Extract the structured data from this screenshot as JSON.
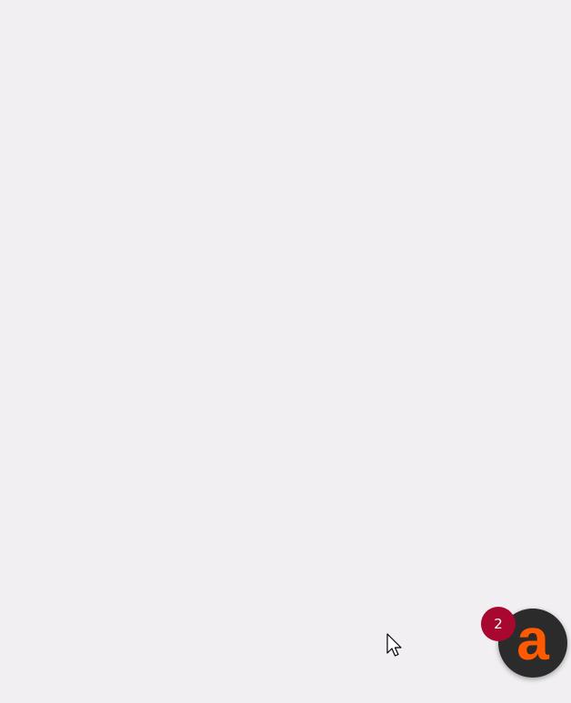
{
  "launcher": {
    "icon": "a-logo-icon",
    "letter": "a",
    "background_color": "#2b2b2b",
    "letter_color": "#ff5a00"
  },
  "notification_badge": {
    "count": "2",
    "color": "#a8082f"
  },
  "page": {
    "background_color": "#f2eff3"
  },
  "cursor": {
    "icon": "mouse-pointer-icon"
  }
}
